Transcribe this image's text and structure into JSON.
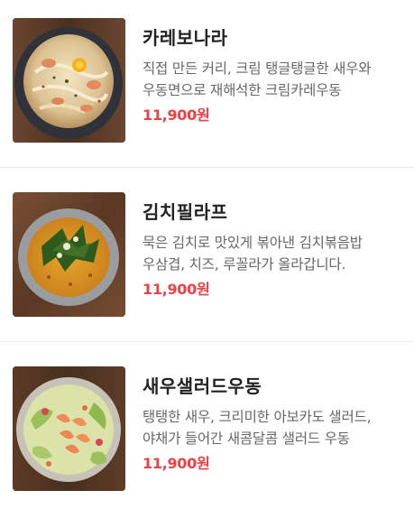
{
  "colors": {
    "price": "#ef4044",
    "title": "#222222",
    "description": "#666666",
    "divider": "#ebebeb"
  },
  "menu": [
    {
      "name": "카레보나라",
      "description": "직접 만든 커리, 크림 탱글탱글한 새우와 우동면으로 재해석한 크림카레우동",
      "price": "11,900원",
      "image": "carbonara-curry-udon-photo"
    },
    {
      "name": "김치필라프",
      "description": "묵은 김치로 맛있게 볶아낸 김치볶음밥 우삼겹, 치즈, 루꼴라가 올라갑니다.",
      "price": "11,900원",
      "image": "kimchi-pilaf-photo"
    },
    {
      "name": "새우샐러드우동",
      "description": "탱탱한 새우, 크리미한 아보카도 샐러드, 야채가 들어간 새콤달콤 샐러드 우동",
      "price": "11,900원",
      "image": "shrimp-salad-udon-photo"
    }
  ]
}
